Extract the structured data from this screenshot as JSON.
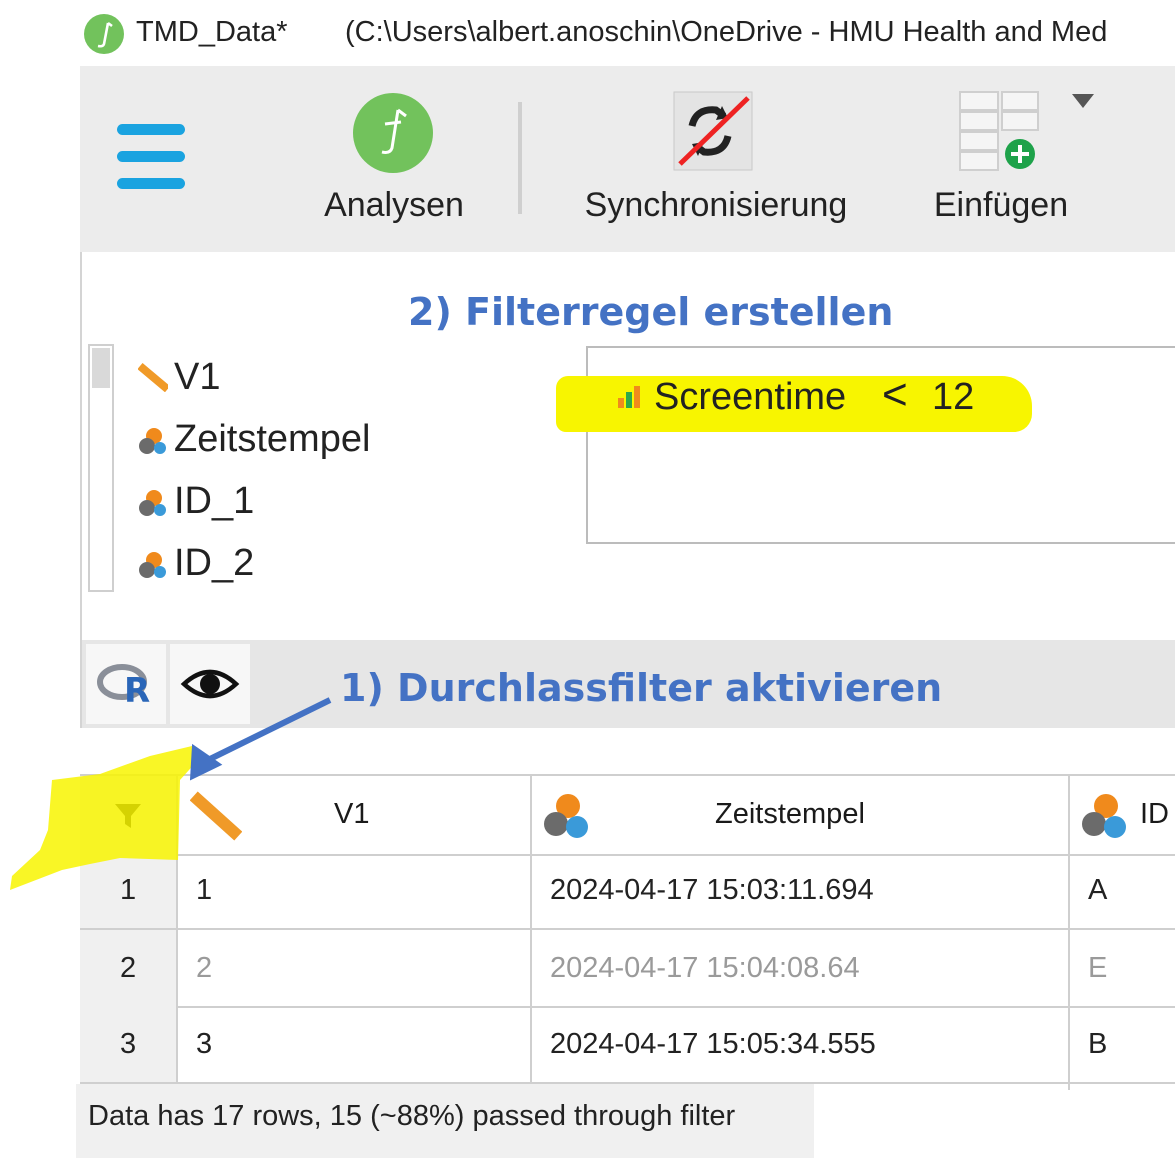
{
  "window": {
    "app_title": "TMD_Data*",
    "path": "(C:\\Users\\albert.anoschin\\OneDrive - HMU Health and Med"
  },
  "ribbon": {
    "analyses_label": "Analysen",
    "sync_label": "Synchronisierung",
    "insert_label": "Einfügen"
  },
  "annotations": {
    "step2": "2) Filterregel erstellen",
    "step1": "1) Durchlassfilter aktivieren"
  },
  "variables": [
    {
      "name": "V1",
      "icon": "scale-ruler-icon"
    },
    {
      "name": "Zeitstempel",
      "icon": "nominal-icon"
    },
    {
      "name": "ID_1",
      "icon": "nominal-icon"
    },
    {
      "name": "ID_2",
      "icon": "nominal-icon"
    }
  ],
  "filter_rule": {
    "variable": "Screentime",
    "operator": "<",
    "value": "12"
  },
  "table": {
    "headers": [
      "V1",
      "Zeitstempel",
      "ID"
    ],
    "rows": [
      {
        "num": "1",
        "v1": "1",
        "ts": "2024-04-17 15:03:11.694",
        "id": "A",
        "filtered": false
      },
      {
        "num": "2",
        "v1": "2",
        "ts": "2024-04-17 15:04:08.64",
        "id": "E",
        "filtered": true
      },
      {
        "num": "3",
        "v1": "3",
        "ts": "2024-04-17 15:05:34.555",
        "id": "B",
        "filtered": false
      }
    ]
  },
  "status": "Data has 17 rows, 15 (~88%) passed through filter",
  "colors": {
    "annotation_blue": "#4472c4",
    "highlight_yellow": "#f8f500",
    "menu_blue": "#1aa3e0",
    "jamovi_green": "#72c25c"
  }
}
